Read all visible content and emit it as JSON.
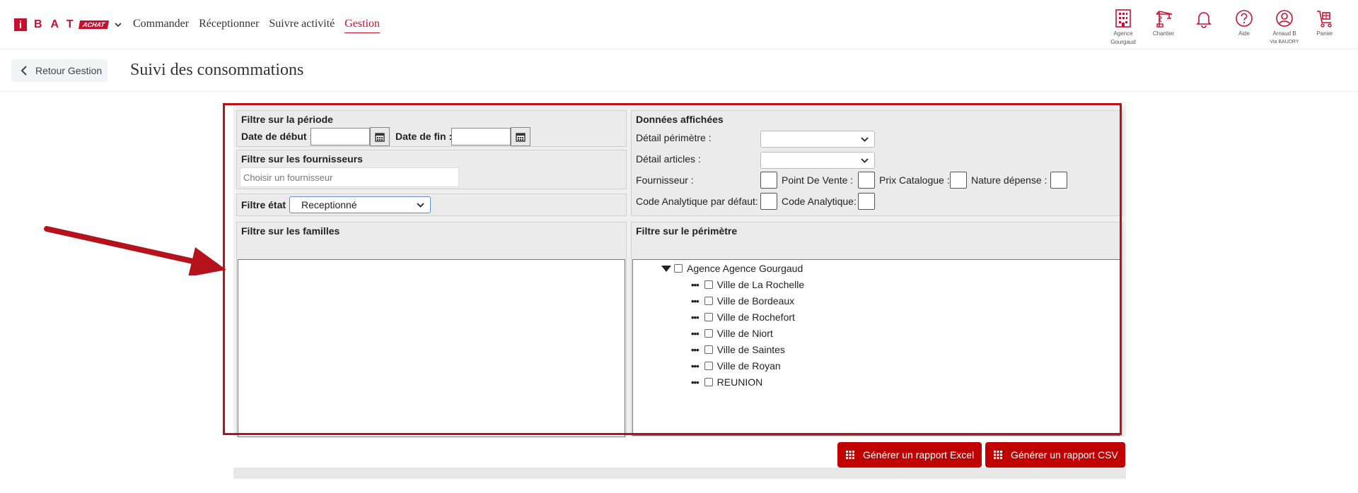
{
  "app": {
    "logo_i": "i",
    "logo_letters": "BAT",
    "logo_badge": "ACHAT"
  },
  "nav": [
    {
      "label": "Commander",
      "active": false
    },
    {
      "label": "Réceptionner",
      "active": false
    },
    {
      "label": "Suivre activité",
      "active": false
    },
    {
      "label": "Gestion",
      "active": true
    }
  ],
  "header_icons": [
    {
      "icon": "building-icon",
      "label1": "Agence",
      "label2": "Gourgaud"
    },
    {
      "icon": "crane-icon",
      "label1": "Chantier",
      "label2": ""
    },
    {
      "icon": "bell-icon",
      "label1": "",
      "label2": ""
    },
    {
      "icon": "help-icon",
      "label1": "Aide",
      "label2": ""
    },
    {
      "icon": "user-icon",
      "label1": "Arnaud B",
      "label2": "Via BAUDRY"
    },
    {
      "icon": "cart-icon",
      "label1": "Panier",
      "label2": ""
    }
  ],
  "subheader": {
    "back_label": "Retour Gestion",
    "page_title": "Suivi des consommations"
  },
  "period": {
    "title": "Filtre sur la période",
    "start_label": "Date de début :",
    "end_label": "Date de fin :",
    "start_value": "",
    "end_value": ""
  },
  "suppliers": {
    "title": "Filtre sur les fournisseurs",
    "placeholder": "Choisir un fournisseur"
  },
  "state": {
    "label": "Filtre état :",
    "selected": "Receptionné"
  },
  "displayed": {
    "title": "Données affichées",
    "perimeter_label": "Détail périmètre :",
    "articles_label": "Détail articles :",
    "perimeter_value": "",
    "articles_value": "",
    "fournisseur_label": "Fournisseur :",
    "pdv_label": "Point De Vente :",
    "prix_label": "Prix Catalogue :",
    "nature_label": "Nature dépense :",
    "code_default_label": "Code Analytique par défaut:",
    "code_label": "Code Analytique:"
  },
  "families": {
    "title": "Filtre sur les familles"
  },
  "perimeter": {
    "title": "Filtre sur le périmètre",
    "root": "Agence Agence Gourgaud",
    "children": [
      "Ville de La Rochelle",
      "Ville de Bordeaux",
      "Ville de Rochefort",
      "Ville de Niort",
      "Ville de Saintes",
      "Ville de Royan",
      "REUNION"
    ]
  },
  "actions": {
    "excel_label": "Générer un rapport Excel",
    "csv_label": "Générer un rapport CSV"
  },
  "colors": {
    "brand": "#c8102e",
    "button": "#c00000",
    "highlight": "#b5121b"
  }
}
